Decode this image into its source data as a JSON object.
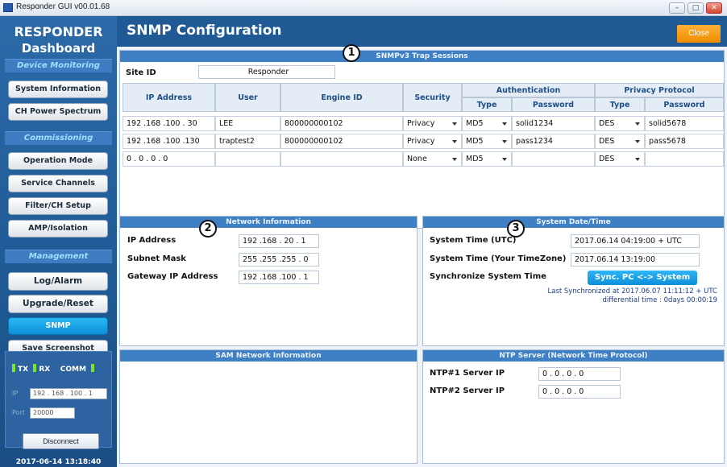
{
  "window": {
    "title": "Responder GUI v00.01.68",
    "minimize_symbol": "–",
    "maximize_symbol": "□",
    "close_symbol": "✕"
  },
  "sidebar": {
    "brand_line1": "RESPONDER",
    "brand_line2": "Dashboard",
    "sections": {
      "device_monitoring": "Device Monitoring",
      "commissioning": "Commissioning",
      "management": "Management"
    },
    "items": {
      "system_information": "System Information",
      "ch_power_spectrum": "CH Power Spectrum",
      "operation_mode": "Operation Mode",
      "service_channels": "Service Channels",
      "filter_ch_setup": "Filter/CH Setup",
      "amp_isolation": "AMP/Isolation",
      "log_alarm": "Log/Alarm",
      "upgrade_reset": "Upgrade/Reset",
      "snmp": "SNMP",
      "save_screenshot": "Save Screenshot"
    },
    "status": {
      "tx": "TX",
      "rx": "RX",
      "comm": "COMM",
      "ip_label": "IP",
      "ip_value": "192 . 168 . 100 . 1",
      "port_label": "Port",
      "port_value": "20000",
      "disconnect": "Disconnect"
    },
    "datetime": "2017-06-14 13:18:40"
  },
  "header": {
    "title": "SNMP Configuration",
    "close": "Close"
  },
  "markers": {
    "one": "1",
    "two": "2",
    "three": "3"
  },
  "trap_sessions": {
    "title": "SNMPv3 Trap Sessions",
    "site_id_label": "Site ID",
    "site_id_value": "Responder",
    "columns": {
      "ip": "IP Address",
      "user": "User",
      "engine": "Engine ID",
      "security": "Security",
      "authentication": "Authentication",
      "privacy": "Privacy Protocol",
      "type": "Type",
      "password": "Password"
    },
    "rows": [
      {
        "ip": "192 .168 .100 . 30",
        "user": "LEE",
        "engine": "800000000102",
        "security": "Privacy",
        "auth_type": "MD5",
        "auth_pass": "solid1234",
        "priv_type": "DES",
        "priv_pass": "solid5678"
      },
      {
        "ip": "192 .168 .100 .130",
        "user": "traptest2",
        "engine": "800000000102",
        "security": "Privacy",
        "auth_type": "MD5",
        "auth_pass": "pass1234",
        "priv_type": "DES",
        "priv_pass": "pass5678"
      },
      {
        "ip": "0 . 0 . 0 . 0",
        "user": "",
        "engine": "",
        "security": "None",
        "auth_type": "MD5",
        "auth_pass": "",
        "priv_type": "DES",
        "priv_pass": ""
      }
    ]
  },
  "network": {
    "title": "Network Information",
    "ip_label": "IP Address",
    "ip_value": "192 .168 . 20 . 1",
    "mask_label": "Subnet Mask",
    "mask_value": "255 .255 .255 . 0",
    "gw_label": "Gateway IP Address",
    "gw_value": "192 .168 .100 . 1"
  },
  "datetime_panel": {
    "title": "System Date/Time",
    "utc_label": "System Time (UTC)",
    "utc_value": "2017.06.14 04:19:00 + UTC",
    "local_label": "System Time (Your TimeZone)",
    "local_value": "2017.06.14 13:19:00",
    "sync_label": "Synchronize System Time",
    "sync_button": "Sync. PC <-> System",
    "last_sync": "Last Synchronized at 2017.06.07 11:11:12 + UTC",
    "diff": "differential time : 0days 00:00:19"
  },
  "sam": {
    "title": "SAM Network Information"
  },
  "ntp": {
    "title": "NTP Server (Network Time Protocol)",
    "ntp1_label": "NTP#1 Server IP",
    "ntp1_value": "0 . 0 . 0 . 0",
    "ntp2_label": "NTP#2 Server IP",
    "ntp2_value": "0 . 0 . 0 . 0"
  },
  "colors": {
    "sidebar_bg": "#1f5a94",
    "panel_header": "#3f7fc4",
    "active_button": "#0d8fd6",
    "close_button": "#f08c00"
  }
}
